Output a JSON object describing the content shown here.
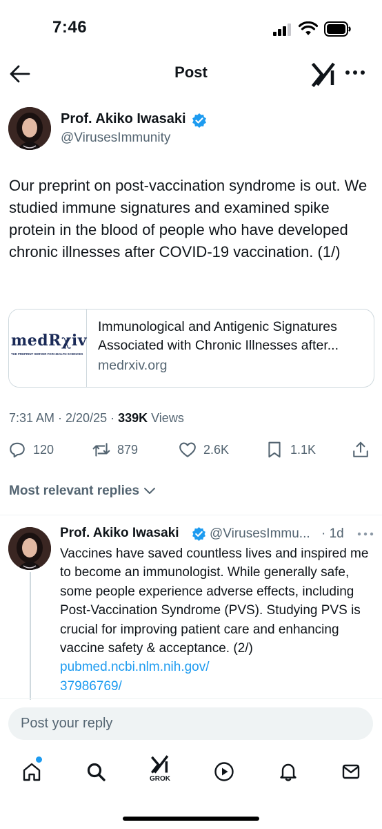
{
  "status_bar": {
    "time": "7:46"
  },
  "header": {
    "title": "Post"
  },
  "post": {
    "author_name": "Prof. Akiko Iwasaki",
    "author_handle": "@VirusesImmunity",
    "text": "Our preprint on post-vaccination syndrome is out. We studied immune signatures and examined spike protein in the blood of people who have developed chronic illnesses after COVID-19 vaccination. (1/)",
    "card": {
      "logo_text": "medRχiv",
      "logo_subtitle": "THE PREPRINT SERVER FOR HEALTH SCIENCES",
      "title_line1": "Immunological and Antigenic Signatures",
      "title_line2": "Associated with Chronic Illnesses after...",
      "domain": "medrxiv.org"
    },
    "timestamp": "7:31 AM · 2/20/25 · ",
    "views_count": "339K",
    "views_label": " Views",
    "stats": {
      "replies": "120",
      "reposts": "879",
      "likes": "2.6K",
      "bookmarks": "1.1K"
    }
  },
  "replies_filter": {
    "label": "Most relevant replies"
  },
  "reply": {
    "author_name": "Prof. Akiko Iwasaki",
    "author_handle": "@VirusesImmu...",
    "time": "· 1d",
    "text": "Vaccines have saved countless lives and inspired me to become an immunologist. While generally safe, some people experience adverse effects, including Post-Vaccination Syndrome (PVS). Studying PVS is crucial for improving patient care and enhancing vaccine safety & acceptance. (2/) ",
    "link_line1": "pubmed.ncbi.nlm.nih.gov/",
    "link_line2": "37986769/"
  },
  "compose": {
    "placeholder": "Post your reply"
  },
  "tabbar": {
    "grok_label": "GROK"
  },
  "colors": {
    "accent": "#1d9bf0",
    "verified": "#1d9bf0",
    "muted": "#536471",
    "brand_red": "#b5121b",
    "brand_navy": "#1a2a57"
  }
}
